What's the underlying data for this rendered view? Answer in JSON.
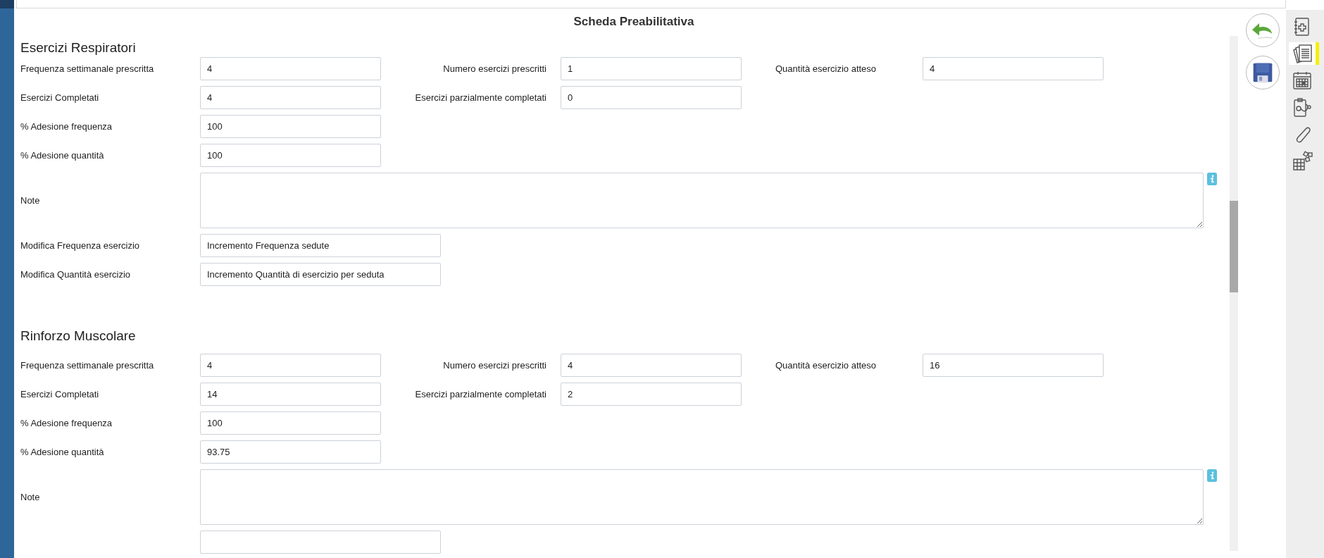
{
  "header": {
    "title": "Scheda Preabilitativa"
  },
  "actions": [
    {
      "kind": "undo"
    },
    {
      "kind": "save"
    }
  ],
  "sidebar": {
    "items": [
      {
        "kind": "new-record",
        "selected": false
      },
      {
        "kind": "documents",
        "selected": true
      },
      {
        "kind": "calendar",
        "selected": false
      },
      {
        "kind": "clinical",
        "selected": false
      },
      {
        "kind": "attachment",
        "selected": false
      },
      {
        "kind": "modules",
        "selected": false
      }
    ]
  },
  "sections": [
    {
      "title": "Esercizi Respiratori",
      "rows": [
        {
          "kind": "fields",
          "fields": [
            {
              "label": "Frequenza settimanale prescritta",
              "value": "4"
            },
            {
              "label": "Numero esercizi prescritti",
              "value": "1"
            },
            {
              "label": "Quantità esercizio atteso",
              "value": "4"
            }
          ]
        },
        {
          "kind": "fields",
          "fields": [
            {
              "label": "Esercizi Completati",
              "value": "4"
            },
            {
              "label": "Esercizi parzialmente completati",
              "value": "0"
            }
          ]
        },
        {
          "kind": "fields",
          "fields": [
            {
              "label": "% Adesione frequenza",
              "value": "100"
            }
          ]
        },
        {
          "kind": "fields",
          "fields": [
            {
              "label": "% Adesione quantità",
              "value": "100"
            }
          ]
        },
        {
          "kind": "note",
          "label": "Note"
        },
        {
          "kind": "wide",
          "label": "Modifica Frequenza esercizio",
          "value": "Incremento Frequenza sedute"
        },
        {
          "kind": "wide",
          "label": "Modifica Quantità esercizio",
          "value": "Incremento Quantità di esercizio per seduta"
        }
      ]
    },
    {
      "title": "Rinforzo Muscolare",
      "rows": [
        {
          "kind": "fields",
          "fields": [
            {
              "label": "Frequenza settimanale prescritta",
              "value": "4"
            },
            {
              "label": "Numero esercizi prescritti",
              "value": "4"
            },
            {
              "label": "Quantità esercizio atteso",
              "value": "16"
            }
          ]
        },
        {
          "kind": "fields",
          "fields": [
            {
              "label": "Esercizi Completati",
              "value": "14"
            },
            {
              "label": "Esercizi parzialmente completati",
              "value": "2"
            }
          ]
        },
        {
          "kind": "fields",
          "fields": [
            {
              "label": "% Adesione frequenza",
              "value": "100"
            }
          ]
        },
        {
          "kind": "fields",
          "fields": [
            {
              "label": "% Adesione quantità",
              "value": "93.75"
            }
          ]
        },
        {
          "kind": "note",
          "label": "Note"
        },
        {
          "kind": "wide"
        }
      ]
    }
  ]
}
